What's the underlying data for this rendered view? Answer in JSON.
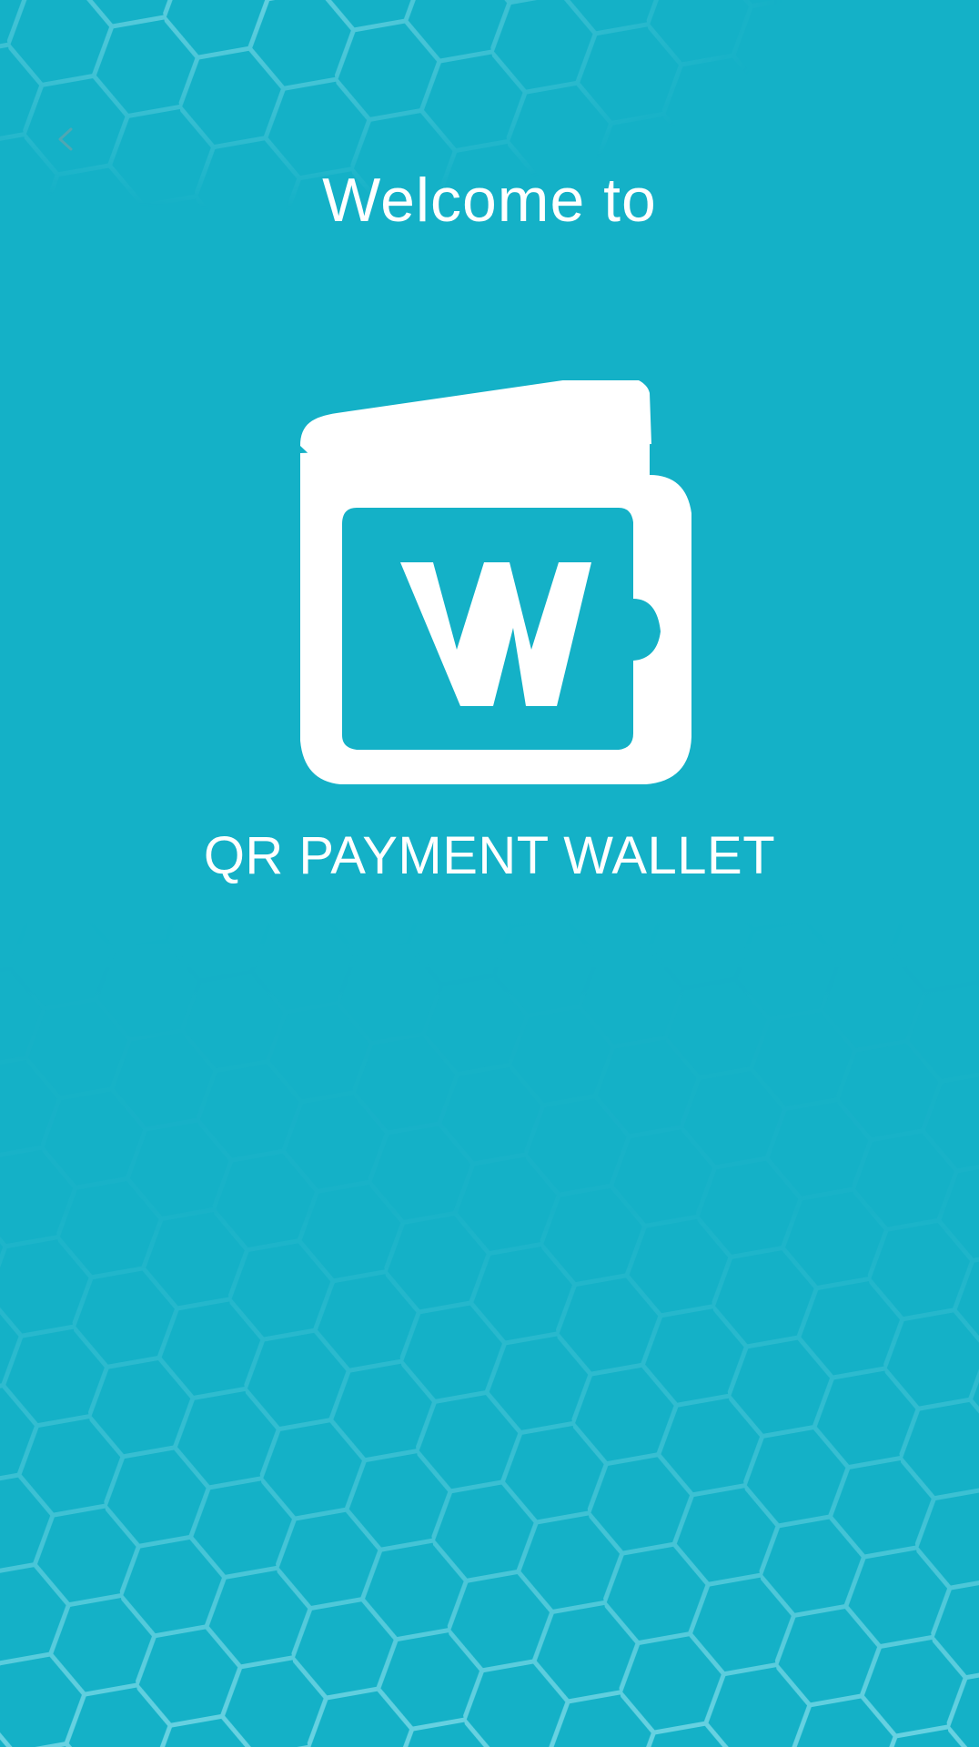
{
  "splash": {
    "welcome_text": "Welcome to",
    "app_name": "QR PAYMENT WALLET",
    "logo_letter": "W"
  },
  "icons": {
    "back": "chevron-left-icon",
    "logo": "wallet-icon"
  },
  "colors": {
    "background": "#14b1c7",
    "foreground": "#ffffff",
    "hexagon_pattern": "#5fd0e0"
  }
}
